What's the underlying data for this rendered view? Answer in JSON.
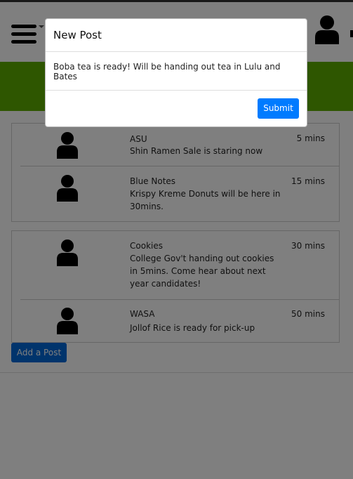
{
  "modal": {
    "title": "New Post",
    "body_text": "Boba tea is ready! Will be handing out tea in Lulu and Bates",
    "submit_label": "Submit"
  },
  "feed": {
    "cards": [
      {
        "posts": [
          {
            "name": "ASU",
            "text": "Shin Ramen Sale is staring now",
            "time": "5 mins"
          },
          {
            "name": "Blue Notes",
            "text": "Krispy Kreme Donuts will be here in 30mins.",
            "time": "15 mins"
          }
        ]
      },
      {
        "posts": [
          {
            "name": "Cookies",
            "text": "College Gov't handing out cookies in 5mins. Come hear about next year candidates!",
            "time": "30 mins"
          },
          {
            "name": "WASA",
            "text": "Jollof Rice is ready for pick-up",
            "time": "50 mins"
          }
        ]
      }
    ]
  },
  "actions": {
    "add_post_label": "Add a Post"
  },
  "colors": {
    "brand_green": "#5cac00",
    "primary_blue": "#007bff"
  },
  "icons": {
    "menu": "hamburger-menu-icon",
    "profile": "user-profile-icon",
    "avatar": "user-avatar-icon"
  }
}
